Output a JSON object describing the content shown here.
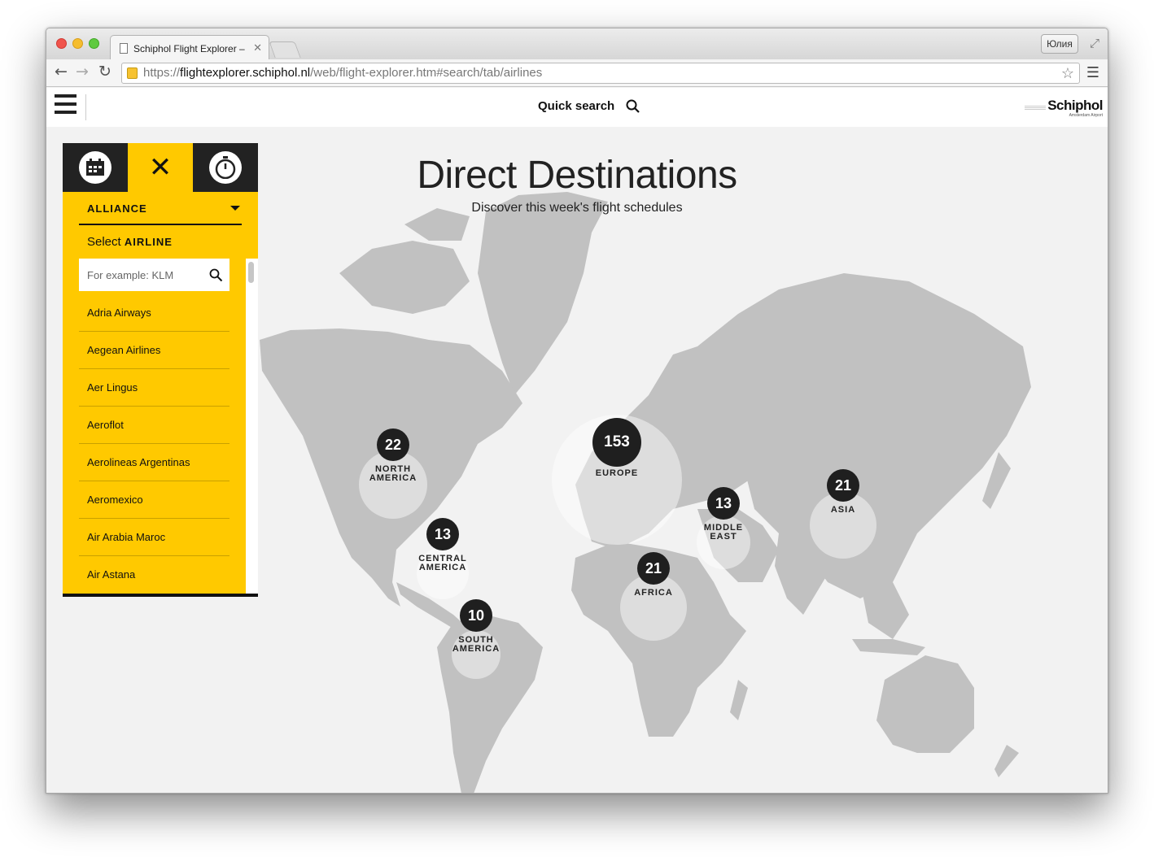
{
  "browser": {
    "tab_title": "Schiphol Flight Explorer – ",
    "profile_name": "Юлия",
    "url_scheme": "https://",
    "url_host": "flightexplorer.schiphol.nl",
    "url_path": "/web/flight-explorer.htm#search/tab/airlines"
  },
  "header": {
    "quick_search_label": "Quick search",
    "logo_name": "Schiphol",
    "logo_sub": "Amsterdam Airport"
  },
  "hero": {
    "title": "Direct Destinations",
    "subtitle": "Discover this week's flight schedules"
  },
  "panel": {
    "dropdown_label": "ALLIANCE",
    "select_prefix": "Select",
    "select_bold": "AIRLINE",
    "search_placeholder": "For example: KLM",
    "airlines": [
      "Adria Airways",
      "Aegean Airlines",
      "Aer Lingus",
      "Aeroflot",
      "Aerolineas Argentinas",
      "Aeromexico",
      "Air Arabia Maroc",
      "Air Astana"
    ]
  },
  "regions": [
    {
      "id": "north-america",
      "count": "22",
      "label": "NORTH\nAMERICA"
    },
    {
      "id": "europe",
      "count": "153",
      "label": "EUROPE"
    },
    {
      "id": "asia",
      "count": "21",
      "label": "ASIA"
    },
    {
      "id": "middle-east",
      "count": "13",
      "label": "MIDDLE\nEAST"
    },
    {
      "id": "central-america",
      "count": "13",
      "label": "CENTRAL\nAMERICA"
    },
    {
      "id": "africa",
      "count": "21",
      "label": "AFRICA"
    },
    {
      "id": "south-america",
      "count": "10",
      "label": "SOUTH\nAMERICA"
    }
  ],
  "colors": {
    "accent": "#ffc900",
    "map_land": "#c1c1c1",
    "background": "#f2f2f2",
    "marker": "#1f1f1f"
  }
}
